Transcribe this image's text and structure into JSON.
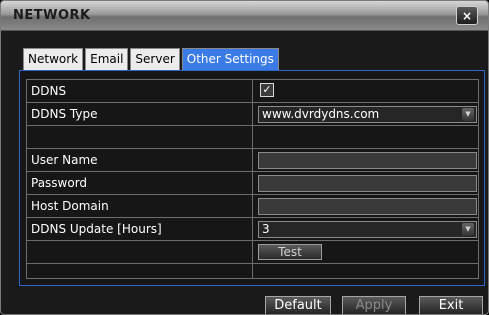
{
  "window": {
    "title": "NETWORK",
    "close_label": "×"
  },
  "tabs": [
    {
      "label": "Network",
      "active": false
    },
    {
      "label": "Email",
      "active": false
    },
    {
      "label": "Server",
      "active": false
    },
    {
      "label": "Other Settings",
      "active": true
    }
  ],
  "form": {
    "ddns": {
      "label": "DDNS",
      "checked": true,
      "check_mark": "✓"
    },
    "ddns_type": {
      "label": "DDNS Type",
      "value": "www.dvrdydns.com"
    },
    "user_name": {
      "label": "User Name",
      "value": ""
    },
    "password": {
      "label": "Password",
      "value": ""
    },
    "host_domain": {
      "label": "Host Domain",
      "value": ""
    },
    "update_hours": {
      "label": "DDNS Update [Hours]",
      "value": "3"
    },
    "test_label": "Test"
  },
  "footer": {
    "default_label": "Default",
    "apply_label": "Apply",
    "exit_label": "Exit"
  }
}
